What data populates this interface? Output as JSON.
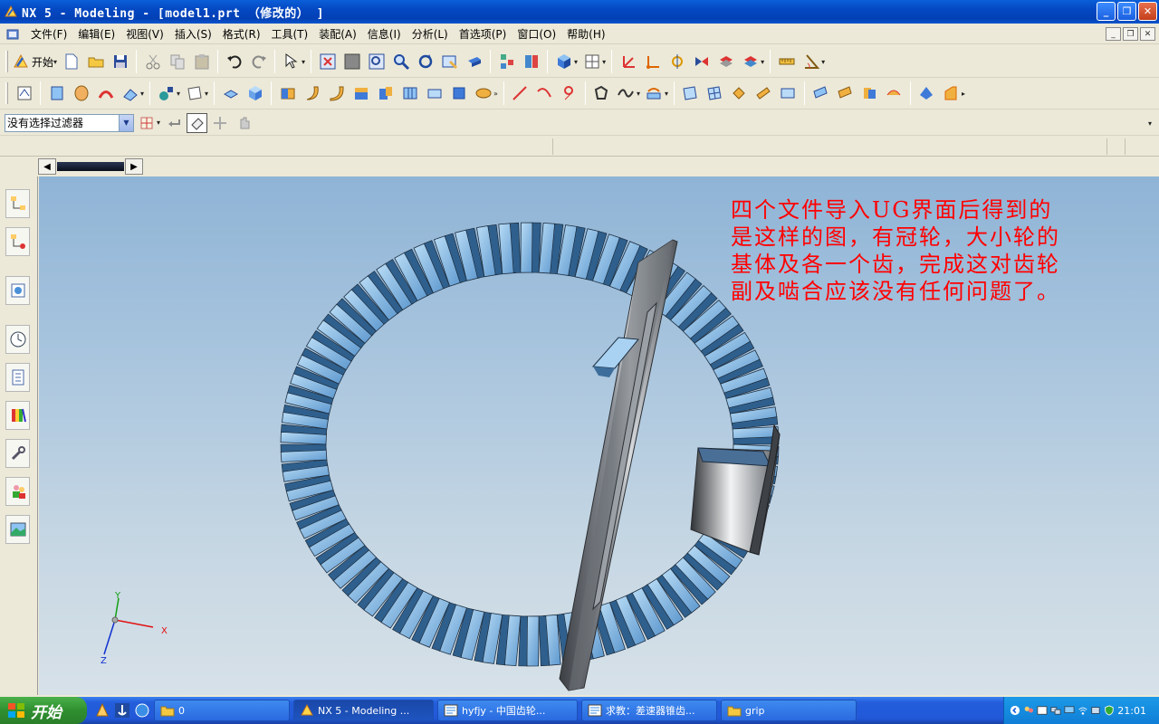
{
  "window": {
    "title": "NX 5 - Modeling - [model1.prt （修改的） ]"
  },
  "menubar": {
    "items": [
      "文件(F)",
      "编辑(E)",
      "视图(V)",
      "插入(S)",
      "格式(R)",
      "工具(T)",
      "装配(A)",
      "信息(I)",
      "分析(L)",
      "首选项(P)",
      "窗口(O)",
      "帮助(H)"
    ]
  },
  "toolbar1": {
    "start_label": "开始"
  },
  "filterbar": {
    "selection_filter": "没有选择过滤器"
  },
  "viewport": {
    "annotation": "四个文件导入UG界面后得到的是这样的图，有冠轮，大小轮的基体及各一个齿，完成这对齿轮副及啮合应该没有任何问题了。",
    "annotation_color": "#ff0000",
    "axis_labels": {
      "x": "X",
      "y": "Y",
      "z": "Z"
    }
  },
  "taskbar": {
    "start_label": "开始",
    "tasks": [
      {
        "label": "0",
        "icon": "folder-icon"
      },
      {
        "label": "NX 5 - Modeling ...",
        "icon": "nx-icon"
      },
      {
        "label": "hyfjy - 中国齿轮...",
        "icon": "browser-icon"
      },
      {
        "label": "求教：差速器锥齿...",
        "icon": "browser-icon"
      },
      {
        "label": "grip",
        "icon": "folder-icon"
      }
    ],
    "clock": "21:01"
  }
}
